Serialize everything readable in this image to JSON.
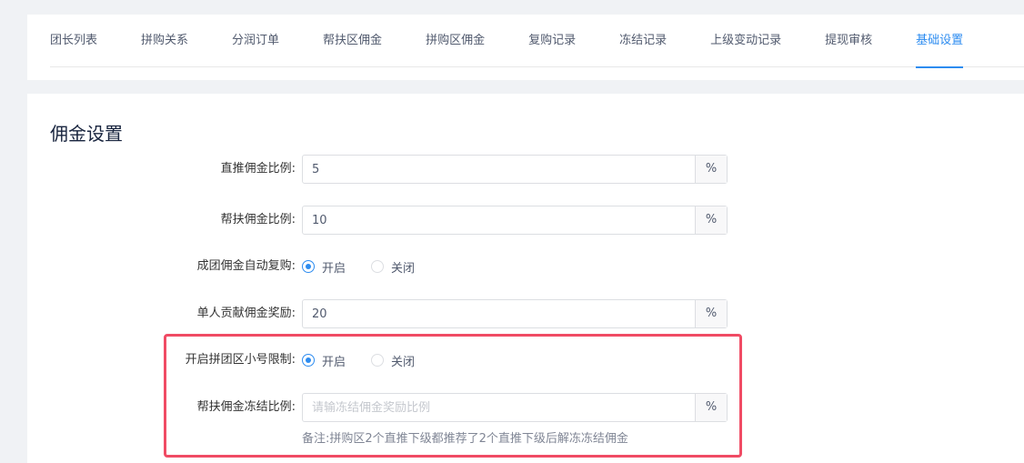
{
  "tabs": [
    {
      "label": "团长列表",
      "active": false
    },
    {
      "label": "拼购关系",
      "active": false
    },
    {
      "label": "分润订单",
      "active": false
    },
    {
      "label": "帮扶区佣金",
      "active": false
    },
    {
      "label": "拼购区佣金",
      "active": false
    },
    {
      "label": "复购记录",
      "active": false
    },
    {
      "label": "冻结记录",
      "active": false
    },
    {
      "label": "上级变动记录",
      "active": false
    },
    {
      "label": "提现审核",
      "active": false
    },
    {
      "label": "基础设置",
      "active": true
    }
  ],
  "section": {
    "title": "佣金设置"
  },
  "form": {
    "direct_ratio": {
      "label": "直推佣金比例:",
      "value": "5",
      "suffix": "%"
    },
    "support_ratio": {
      "label": "帮扶佣金比例:",
      "value": "10",
      "suffix": "%"
    },
    "auto_repurchase": {
      "label": "成团佣金自动复购:",
      "on_label": "开启",
      "off_label": "关闭",
      "selected": "on"
    },
    "single_contribution": {
      "label": "单人贡献佣金奖励:",
      "value": "20",
      "suffix": "%"
    },
    "alt_account_limit": {
      "label": "开启拼团区小号限制:",
      "on_label": "开启",
      "off_label": "关闭",
      "selected": "on"
    },
    "freeze_ratio": {
      "label": "帮扶佣金冻结比例:",
      "value": "",
      "placeholder": "请输冻结佣金奖励比例",
      "suffix": "%"
    },
    "note": "备注:拼购区2个直推下级都推荐了2个直推下级后解冻冻结佣金"
  },
  "colors": {
    "accent": "#2d8cf0",
    "highlight": "#f04b64"
  }
}
